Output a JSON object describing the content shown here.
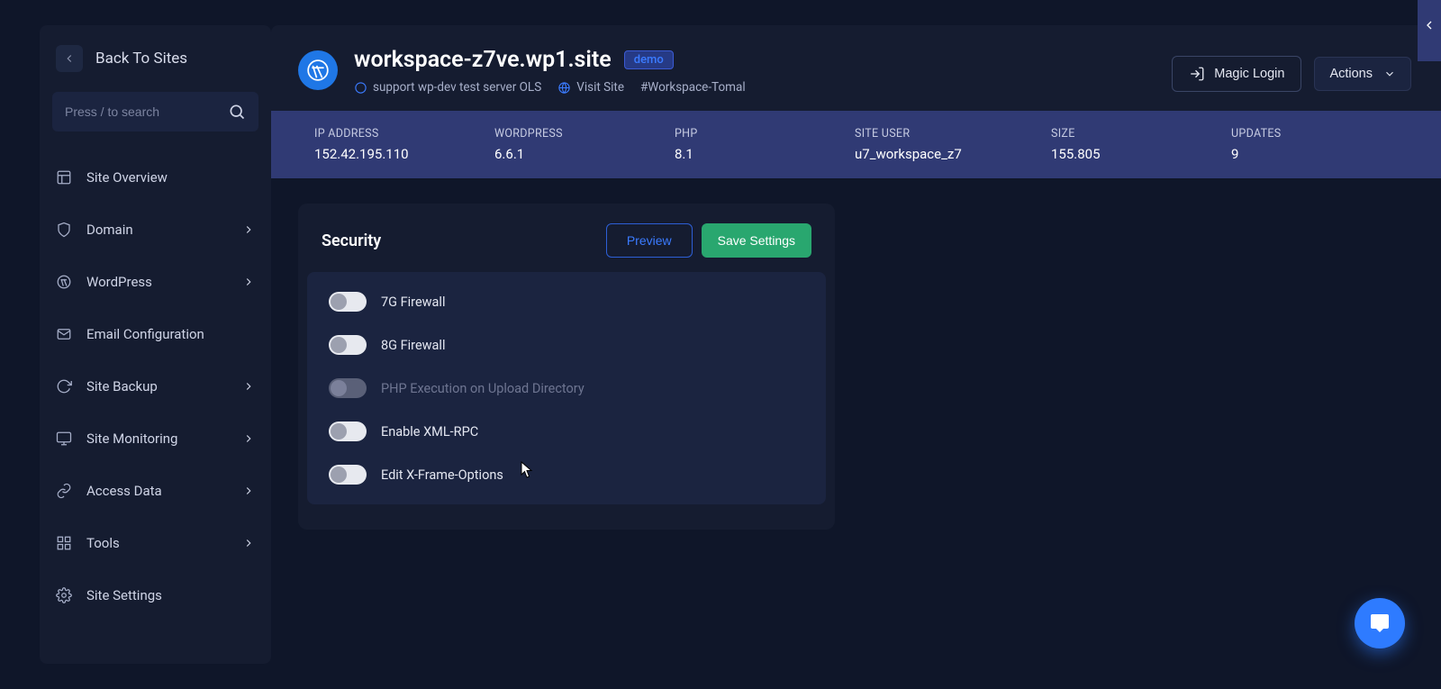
{
  "sidebar": {
    "back_label": "Back To Sites",
    "search_placeholder": "Press / to search",
    "items": [
      {
        "icon": "layout",
        "label": "Site Overview",
        "expandable": false
      },
      {
        "icon": "shield",
        "label": "Domain",
        "expandable": true
      },
      {
        "icon": "wordpress",
        "label": "WordPress",
        "expandable": true
      },
      {
        "icon": "mail",
        "label": "Email Configuration",
        "expandable": false
      },
      {
        "icon": "refresh",
        "label": "Site Backup",
        "expandable": true
      },
      {
        "icon": "monitor",
        "label": "Site Monitoring",
        "expandable": true
      },
      {
        "icon": "link",
        "label": "Access Data",
        "expandable": true
      },
      {
        "icon": "grid",
        "label": "Tools",
        "expandable": true
      },
      {
        "icon": "gear",
        "label": "Site Settings",
        "expandable": false
      }
    ]
  },
  "header": {
    "title": "workspace-z7ve.wp1.site",
    "badge": "demo",
    "server_label": "support wp-dev test server OLS",
    "visit_label": "Visit Site",
    "hash": "#Workspace-Tomal",
    "magic_login": "Magic Login",
    "actions": "Actions"
  },
  "stats": [
    {
      "label": "IP ADDRESS",
      "value": "152.42.195.110"
    },
    {
      "label": "WORDPRESS",
      "value": "6.6.1"
    },
    {
      "label": "PHP",
      "value": "8.1"
    },
    {
      "label": "SITE USER",
      "value": "u7_workspace_z7"
    },
    {
      "label": "SIZE",
      "value": "155.805"
    },
    {
      "label": "UPDATES",
      "value": "9"
    }
  ],
  "security": {
    "title": "Security",
    "preview": "Preview",
    "save": "Save Settings",
    "toggles": [
      {
        "label": "7G Firewall",
        "state": "off",
        "disabled": false
      },
      {
        "label": "8G Firewall",
        "state": "off",
        "disabled": false
      },
      {
        "label": "PHP Execution on Upload Directory",
        "state": "off",
        "disabled": true
      },
      {
        "label": "Enable XML-RPC",
        "state": "off",
        "disabled": false
      },
      {
        "label": "Edit X-Frame-Options",
        "state": "off",
        "disabled": false
      }
    ]
  },
  "colors": {
    "bg": "#0f1629",
    "panel": "#151c30",
    "panel2": "#1b2440",
    "bar": "#303a74",
    "accent": "#3b7bff",
    "save": "#29a76f",
    "chat": "#2e7bff"
  }
}
